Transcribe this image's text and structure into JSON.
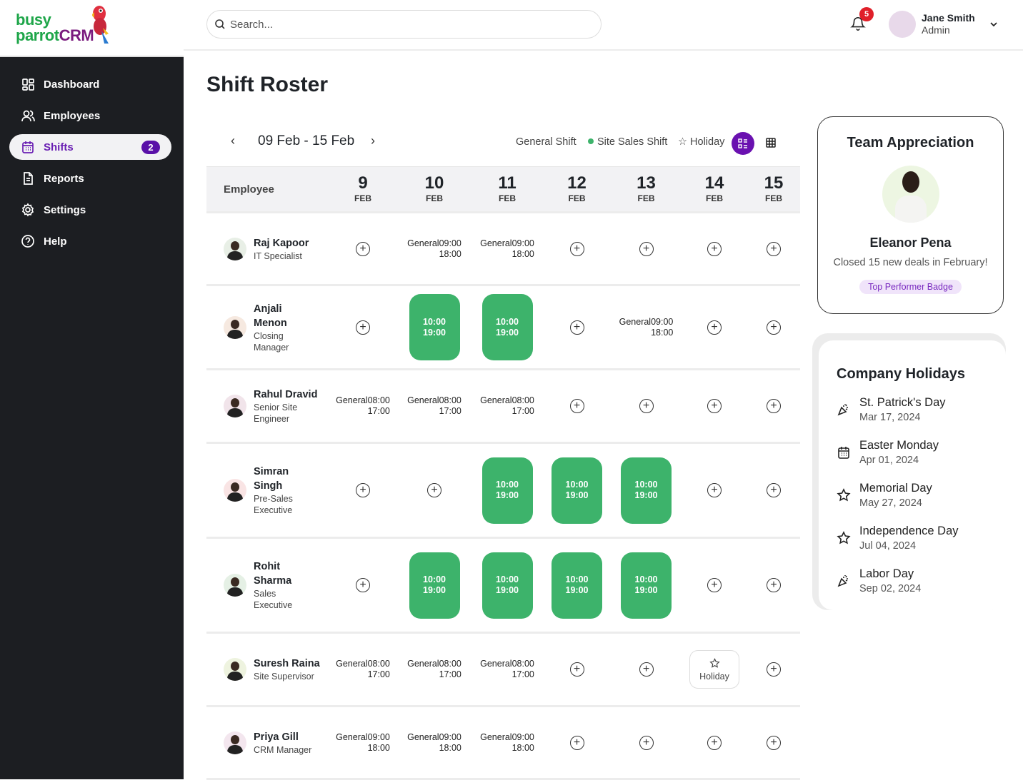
{
  "brand": {
    "line1": "busy",
    "line2a": "parrot",
    "line2b": "CRM"
  },
  "sidebar": {
    "items": [
      {
        "label": "Dashboard",
        "icon": "dashboard-icon"
      },
      {
        "label": "Employees",
        "icon": "users-icon"
      },
      {
        "label": "Shifts",
        "icon": "calendar-icon",
        "badge": "2",
        "active": true
      },
      {
        "label": "Reports",
        "icon": "document-icon"
      },
      {
        "label": "Settings",
        "icon": "gear-icon"
      },
      {
        "label": "Help",
        "icon": "help-icon"
      }
    ]
  },
  "topbar": {
    "search_placeholder": "Search...",
    "notifications": "5",
    "user": {
      "name": "Jane Smith",
      "role": "Admin"
    }
  },
  "page": {
    "title": "Shift Roster"
  },
  "roster": {
    "range": "09 Feb - 15 Feb",
    "legend": {
      "general": "General Shift",
      "site": "Site Sales Shift",
      "holiday": "Holiday"
    },
    "colors": {
      "site": "#3db36b",
      "accent": "#6a11b0"
    },
    "employee_header": "Employee",
    "days": [
      {
        "n": "9",
        "m": "FEB"
      },
      {
        "n": "10",
        "m": "FEB"
      },
      {
        "n": "11",
        "m": "FEB"
      },
      {
        "n": "12",
        "m": "FEB"
      },
      {
        "n": "13",
        "m": "FEB"
      },
      {
        "n": "14",
        "m": "FEB"
      },
      {
        "n": "15",
        "m": "FEB"
      }
    ],
    "rows": [
      {
        "name": "Raj Kapoor",
        "role": "IT Specialist",
        "h": 102,
        "cells": [
          {
            "t": "add"
          },
          {
            "t": "gen",
            "label": "General",
            "start": "09:00",
            "end": "18:00"
          },
          {
            "t": "gen",
            "label": "General",
            "start": "09:00",
            "end": "18:00"
          },
          {
            "t": "add"
          },
          {
            "t": "add"
          },
          {
            "t": "add"
          },
          {
            "t": "add"
          }
        ]
      },
      {
        "name": "Anjali Menon",
        "role": "Closing Manager",
        "h": 118,
        "cells": [
          {
            "t": "add"
          },
          {
            "t": "site",
            "start": "10:00",
            "end": "19:00"
          },
          {
            "t": "site",
            "start": "10:00",
            "end": "19:00"
          },
          {
            "t": "add"
          },
          {
            "t": "gen",
            "label": "General",
            "start": "09:00",
            "end": "18:00"
          },
          {
            "t": "add"
          },
          {
            "t": "add"
          }
        ]
      },
      {
        "name": "Rahul Dravid",
        "role": "Senior Site Engineer",
        "h": 103,
        "cells": [
          {
            "t": "gen",
            "label": "General",
            "start": "08:00",
            "end": "17:00"
          },
          {
            "t": "gen",
            "label": "General",
            "start": "08:00",
            "end": "17:00"
          },
          {
            "t": "gen",
            "label": "General",
            "start": "08:00",
            "end": "17:00"
          },
          {
            "t": "add"
          },
          {
            "t": "add"
          },
          {
            "t": "add"
          },
          {
            "t": "add"
          }
        ]
      },
      {
        "name": "Simran Singh",
        "role": "Pre-Sales Executive",
        "h": 133,
        "cells": [
          {
            "t": "add"
          },
          {
            "t": "add"
          },
          {
            "t": "site",
            "start": "10:00",
            "end": "19:00"
          },
          {
            "t": "site",
            "start": "10:00",
            "end": "19:00"
          },
          {
            "t": "site",
            "start": "10:00",
            "end": "19:00"
          },
          {
            "t": "add"
          },
          {
            "t": "add"
          }
        ]
      },
      {
        "name": "Rohit Sharma",
        "role": "Sales Executive",
        "h": 133,
        "cells": [
          {
            "t": "add"
          },
          {
            "t": "site",
            "start": "10:00",
            "end": "19:00"
          },
          {
            "t": "site",
            "start": "10:00",
            "end": "19:00"
          },
          {
            "t": "site",
            "start": "10:00",
            "end": "19:00"
          },
          {
            "t": "site",
            "start": "10:00",
            "end": "19:00"
          },
          {
            "t": "add"
          },
          {
            "t": "add"
          }
        ]
      },
      {
        "name": "Suresh Raina",
        "role": "Site Supervisor",
        "h": 103,
        "cells": [
          {
            "t": "gen",
            "label": "General",
            "start": "08:00",
            "end": "17:00"
          },
          {
            "t": "gen",
            "label": "General",
            "start": "08:00",
            "end": "17:00"
          },
          {
            "t": "gen",
            "label": "General",
            "start": "08:00",
            "end": "17:00"
          },
          {
            "t": "add"
          },
          {
            "t": "add"
          },
          {
            "t": "hol",
            "label": "Holiday"
          },
          {
            "t": "add"
          }
        ]
      },
      {
        "name": "Priya Gill",
        "role": "CRM Manager",
        "h": 102,
        "cells": [
          {
            "t": "gen",
            "label": "General",
            "start": "09:00",
            "end": "18:00"
          },
          {
            "t": "gen",
            "label": "General",
            "start": "09:00",
            "end": "18:00"
          },
          {
            "t": "gen",
            "label": "General",
            "start": "09:00",
            "end": "18:00"
          },
          {
            "t": "add"
          },
          {
            "t": "add"
          },
          {
            "t": "add"
          },
          {
            "t": "add"
          }
        ]
      }
    ]
  },
  "appreciation": {
    "title": "Team Appreciation",
    "name": "Eleanor Pena",
    "desc": "Closed 15 new deals in February!",
    "badge": "Top Performer Badge"
  },
  "holidays": {
    "title": "Company Holidays",
    "items": [
      {
        "name": "St. Patrick's Day",
        "date": "Mar 17, 2024",
        "icon": "party-icon"
      },
      {
        "name": "Easter Monday",
        "date": "Apr 01, 2024",
        "icon": "calendar-icon"
      },
      {
        "name": "Memorial Day",
        "date": "May 27, 2024",
        "icon": "star-icon"
      },
      {
        "name": "Independence Day",
        "date": "Jul 04, 2024",
        "icon": "star-icon"
      },
      {
        "name": "Labor Day",
        "date": "Sep 02, 2024",
        "icon": "party-icon"
      }
    ]
  }
}
